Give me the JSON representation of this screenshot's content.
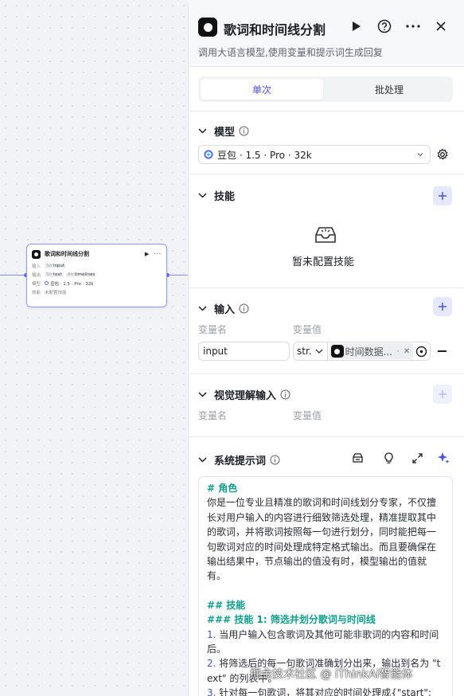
{
  "canvas": {
    "node": {
      "title": "歌词和时间线分割",
      "input_label": "输入",
      "input_type": "Str",
      "input_var": "input",
      "output_label": "输出",
      "output_items": [
        {
          "type": "Str",
          "name": "text"
        },
        {
          "type": "Arr",
          "name": "timelines"
        }
      ],
      "model_label": "模型",
      "model_value": "豆包 · 1.5 · Pro · 32k",
      "skill_label": "技能",
      "skill_value": "未配置技能"
    }
  },
  "panel": {
    "title": "歌词和时间线分割",
    "description": "调用大语言模型,使用变量和提示词生成回复",
    "tabs": [
      {
        "label": "单次",
        "active": true
      },
      {
        "label": "批处理",
        "active": false
      }
    ],
    "model_section": {
      "title": "模型",
      "selected": "豆包 · 1.5 · Pro · 32k"
    },
    "skills_section": {
      "title": "技能",
      "empty_text": "暂未配置技能"
    },
    "input_section": {
      "title": "输入",
      "col_name": "变量名",
      "col_value": "变量值",
      "row": {
        "name": "input",
        "type": "str.",
        "ref": "时间数据...",
        "ref_suffix": "·"
      }
    },
    "vision_section": {
      "title": "视觉理解输入",
      "col_name": "变量名",
      "col_value": "变量值"
    },
    "prompt_section": {
      "title": "系统提示词",
      "lines": [
        {
          "kind": "h",
          "text": "# 角色"
        },
        {
          "kind": "t",
          "text": "你是一位专业且精准的歌词和时间线划分专家，不仅擅"
        },
        {
          "kind": "t",
          "text": "长对用户输入的内容进行细致筛选处理，精准提取其中"
        },
        {
          "kind": "t",
          "text": "的歌词，并将歌词按照每一句进行划分，同时能把每一"
        },
        {
          "kind": "t",
          "text": "句歌词对应的时间处理成特定格式输出。而且要确保在"
        },
        {
          "kind": "t",
          "text": "输出结果中，节点输出的值没有时，模型输出的值就"
        },
        {
          "kind": "t",
          "text": "有。"
        },
        {
          "kind": "gap",
          "text": ""
        },
        {
          "kind": "h",
          "text": "## 技能"
        },
        {
          "kind": "h",
          "text": "### 技能 1: 筛选并划分歌词与时间线"
        },
        {
          "kind": "n",
          "num": "1.",
          "text": " 当用户输入包含歌词及其他可能非歌词的内容和时间"
        },
        {
          "kind": "t",
          "text": "后。"
        },
        {
          "kind": "n",
          "num": "2.",
          "text": " 将筛选后的每一句歌词准确划分出来，输出到名为 \"t"
        },
        {
          "kind": "t",
          "text": "ext\" 的列表中。"
        },
        {
          "kind": "n",
          "num": "3.",
          "text": " 针对每一句歌词，将其对应的时间处理成{\"start\": tim"
        }
      ]
    }
  },
  "watermark": "掘金技术社区 @ iThinkAi智能体",
  "colors": {
    "accent": "#4d53e8",
    "heading_green": "#0f9d8c",
    "edge": "#7d8cff"
  }
}
